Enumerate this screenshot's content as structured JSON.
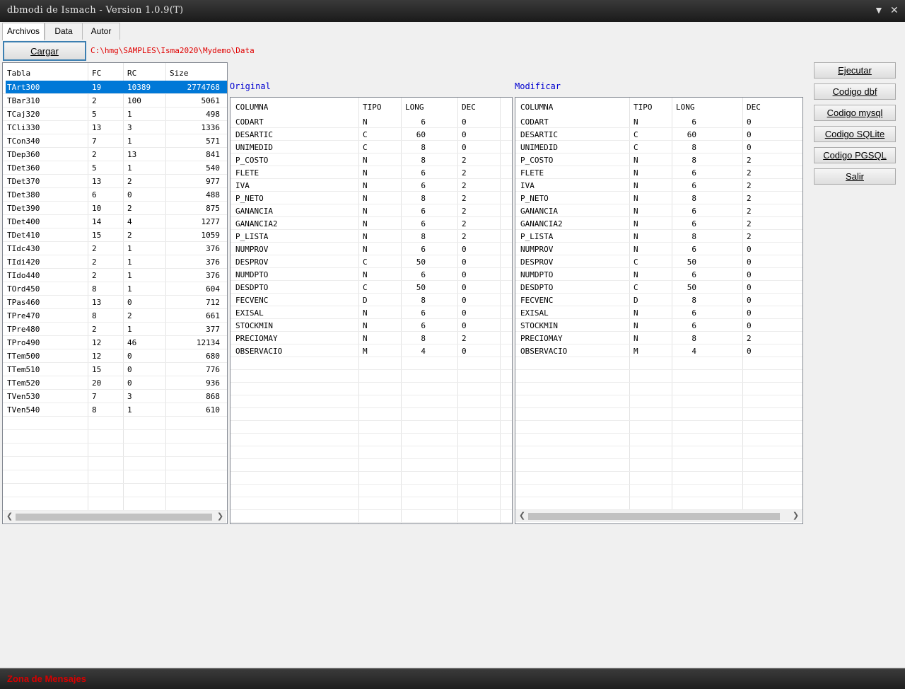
{
  "window": {
    "title": "dbmodi de Ismach - Version 1.0.9(T)"
  },
  "tabs": [
    {
      "label": "Archivos"
    },
    {
      "label": "Data"
    },
    {
      "label": "Autor"
    }
  ],
  "cargar_label": "Cargar",
  "path": "C:\\hmg\\SAMPLES\\Isma2020\\Mydemo\\Data",
  "tables": {
    "headers": [
      "Tabla",
      "FC",
      "RC",
      "Size"
    ],
    "rows": [
      [
        "TArt300",
        "19",
        "10389",
        "2774768"
      ],
      [
        "TBar310",
        "2",
        "100",
        "5061"
      ],
      [
        "TCaj320",
        "5",
        "1",
        "498"
      ],
      [
        "TCli330",
        "13",
        "3",
        "1336"
      ],
      [
        "TCon340",
        "7",
        "1",
        "571"
      ],
      [
        "TDep360",
        "2",
        "13",
        "841"
      ],
      [
        "TDet360",
        "5",
        "1",
        "540"
      ],
      [
        "TDet370",
        "13",
        "2",
        "977"
      ],
      [
        "TDet380",
        "6",
        "0",
        "488"
      ],
      [
        "TDet390",
        "10",
        "2",
        "875"
      ],
      [
        "TDet400",
        "14",
        "4",
        "1277"
      ],
      [
        "TDet410",
        "15",
        "2",
        "1059"
      ],
      [
        "TIdc430",
        "2",
        "1",
        "376"
      ],
      [
        "TIdi420",
        "2",
        "1",
        "376"
      ],
      [
        "TIdo440",
        "2",
        "1",
        "376"
      ],
      [
        "TOrd450",
        "8",
        "1",
        "604"
      ],
      [
        "TPas460",
        "13",
        "0",
        "712"
      ],
      [
        "TPre470",
        "8",
        "2",
        "661"
      ],
      [
        "TPre480",
        "2",
        "1",
        "377"
      ],
      [
        "TPro490",
        "12",
        "46",
        "12134"
      ],
      [
        "TTem500",
        "12",
        "0",
        "680"
      ],
      [
        "TTem510",
        "15",
        "0",
        "776"
      ],
      [
        "TTem520",
        "20",
        "0",
        "936"
      ],
      [
        "TVen530",
        "7",
        "3",
        "868"
      ],
      [
        "TVen540",
        "8",
        "1",
        "610"
      ]
    ]
  },
  "original": {
    "label": "Original",
    "headers": [
      "COLUMNA",
      "TIPO",
      "LONG",
      "DEC"
    ],
    "rows": [
      [
        "CODART",
        "N",
        "6",
        "0"
      ],
      [
        "DESARTIC",
        "C",
        "60",
        "0"
      ],
      [
        "UNIMEDID",
        "C",
        "8",
        "0"
      ],
      [
        "P_COSTO",
        "N",
        "8",
        "2"
      ],
      [
        "FLETE",
        "N",
        "6",
        "2"
      ],
      [
        "IVA",
        "N",
        "6",
        "2"
      ],
      [
        "P_NETO",
        "N",
        "8",
        "2"
      ],
      [
        "GANANCIA",
        "N",
        "6",
        "2"
      ],
      [
        "GANANCIA2",
        "N",
        "6",
        "2"
      ],
      [
        "P_LISTA",
        "N",
        "8",
        "2"
      ],
      [
        "NUMPROV",
        "N",
        "6",
        "0"
      ],
      [
        "DESPROV",
        "C",
        "50",
        "0"
      ],
      [
        "NUMDPTO",
        "N",
        "6",
        "0"
      ],
      [
        "DESDPTO",
        "C",
        "50",
        "0"
      ],
      [
        "FECVENC",
        "D",
        "8",
        "0"
      ],
      [
        "EXISAL",
        "N",
        "6",
        "0"
      ],
      [
        "STOCKMIN",
        "N",
        "6",
        "0"
      ],
      [
        "PRECIOMAY",
        "N",
        "8",
        "2"
      ],
      [
        "OBSERVACIO",
        "M",
        "4",
        "0"
      ]
    ]
  },
  "modificar": {
    "label": "Modificar",
    "headers": [
      "COLUMNA",
      "TIPO",
      "LONG",
      "DEC"
    ],
    "rows": [
      [
        "CODART",
        "N",
        "6",
        "0"
      ],
      [
        "DESARTIC",
        "C",
        "60",
        "0"
      ],
      [
        "UNIMEDID",
        "C",
        "8",
        "0"
      ],
      [
        "P_COSTO",
        "N",
        "8",
        "2"
      ],
      [
        "FLETE",
        "N",
        "6",
        "2"
      ],
      [
        "IVA",
        "N",
        "6",
        "2"
      ],
      [
        "P_NETO",
        "N",
        "8",
        "2"
      ],
      [
        "GANANCIA",
        "N",
        "6",
        "2"
      ],
      [
        "GANANCIA2",
        "N",
        "6",
        "2"
      ],
      [
        "P_LISTA",
        "N",
        "8",
        "2"
      ],
      [
        "NUMPROV",
        "N",
        "6",
        "0"
      ],
      [
        "DESPROV",
        "C",
        "50",
        "0"
      ],
      [
        "NUMDPTO",
        "N",
        "6",
        "0"
      ],
      [
        "DESDPTO",
        "C",
        "50",
        "0"
      ],
      [
        "FECVENC",
        "D",
        "8",
        "0"
      ],
      [
        "EXISAL",
        "N",
        "6",
        "0"
      ],
      [
        "STOCKMIN",
        "N",
        "6",
        "0"
      ],
      [
        "PRECIOMAY",
        "N",
        "8",
        "2"
      ],
      [
        "OBSERVACIO",
        "M",
        "4",
        "0"
      ]
    ]
  },
  "actions": [
    {
      "label": "Ejecutar"
    },
    {
      "label": "Codigo dbf"
    },
    {
      "label": "Codigo mysql"
    },
    {
      "label": "Codigo SQLite"
    },
    {
      "label": "Codigo PGSQL"
    },
    {
      "label": "Salir"
    }
  ],
  "status": {
    "message": "Zona de Mensajes"
  },
  "icons": {
    "minimize": "chevron-down-icon",
    "close": "close-icon",
    "scroll_left": "arrow-left-icon",
    "scroll_right": "arrow-right-icon"
  },
  "colors": {
    "selection": "#0078d7",
    "path": "#e00000",
    "labels": "#0000d0",
    "status": "#d80000"
  }
}
